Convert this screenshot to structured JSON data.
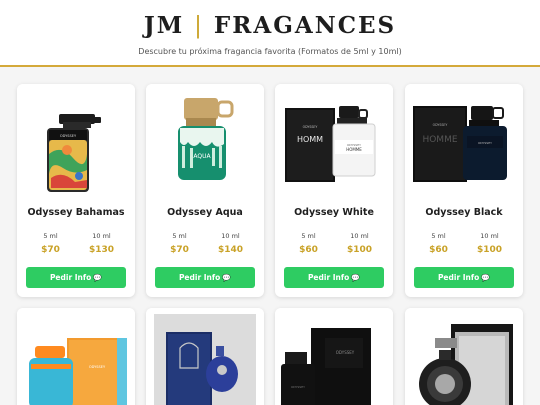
{
  "brand": {
    "left": "JM",
    "separator": "|",
    "right": "FRAGANCES"
  },
  "subtitle": "Descubre tu próxima fragancia favorita (Formatos de 5ml y 10ml)",
  "button_label": "Pedir Info",
  "button_icon": "chat-bubble-icon",
  "colors": {
    "accent_gold": "#c9a227",
    "button_green": "#2ecc62"
  },
  "products": [
    {
      "name": "Odyssey Bahamas",
      "size_a": "5 ml",
      "price_a": "$70",
      "size_b": "10 ml",
      "price_b": "$130"
    },
    {
      "name": "Odyssey Aqua",
      "size_a": "5 ml",
      "price_a": "$70",
      "size_b": "10 ml",
      "price_b": "$140"
    },
    {
      "name": "Odyssey White",
      "size_a": "5 ml",
      "price_a": "$60",
      "size_b": "10 ml",
      "price_b": "$100"
    },
    {
      "name": "Odyssey Black",
      "size_a": "5 ml",
      "price_a": "$60",
      "size_b": "10 ml",
      "price_b": "$100"
    }
  ]
}
